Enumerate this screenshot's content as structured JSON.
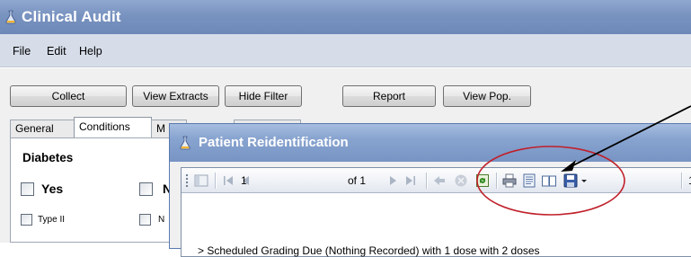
{
  "window": {
    "title": "Clinical Audit",
    "icon": "flask-icon"
  },
  "menu": {
    "items": [
      "File",
      "Edit",
      "Help"
    ]
  },
  "buttons": {
    "collect": "Collect",
    "view_extracts": "View Extracts",
    "hide_filter": "Hide Filter",
    "report": "Report",
    "view_pop": "View Pop."
  },
  "tabs": [
    "General",
    "Conditions",
    "M",
    ""
  ],
  "conditions": {
    "section_title": "Diabetes",
    "yes_label": "Yes",
    "col2_label": "N",
    "type2_label": "Type II",
    "col2_row2_label": "N"
  },
  "dialog": {
    "title": "Patient Reidentification",
    "icon": "flask-icon",
    "toolbar": {
      "page_value": "1",
      "page_of": "of 1",
      "zoom_value": "1",
      "icons": [
        "toggle-tree-icon",
        "first-page-icon",
        "prev-page-icon",
        "next-page-icon",
        "last-page-icon",
        "back-icon",
        "stop-icon",
        "refresh-icon",
        "print-icon",
        "print-layout-icon",
        "page-setup-icon",
        "export-icon"
      ]
    },
    "report_text": "> Scheduled Grading Due (Nothing Recorded) with 1 dose with 2 doses"
  },
  "colors": {
    "titlebar": "#7993c0",
    "dialog_titlebar": "#87a3cf",
    "annotation_circle": "#c0202a",
    "annotation_arrow": "#000000"
  }
}
